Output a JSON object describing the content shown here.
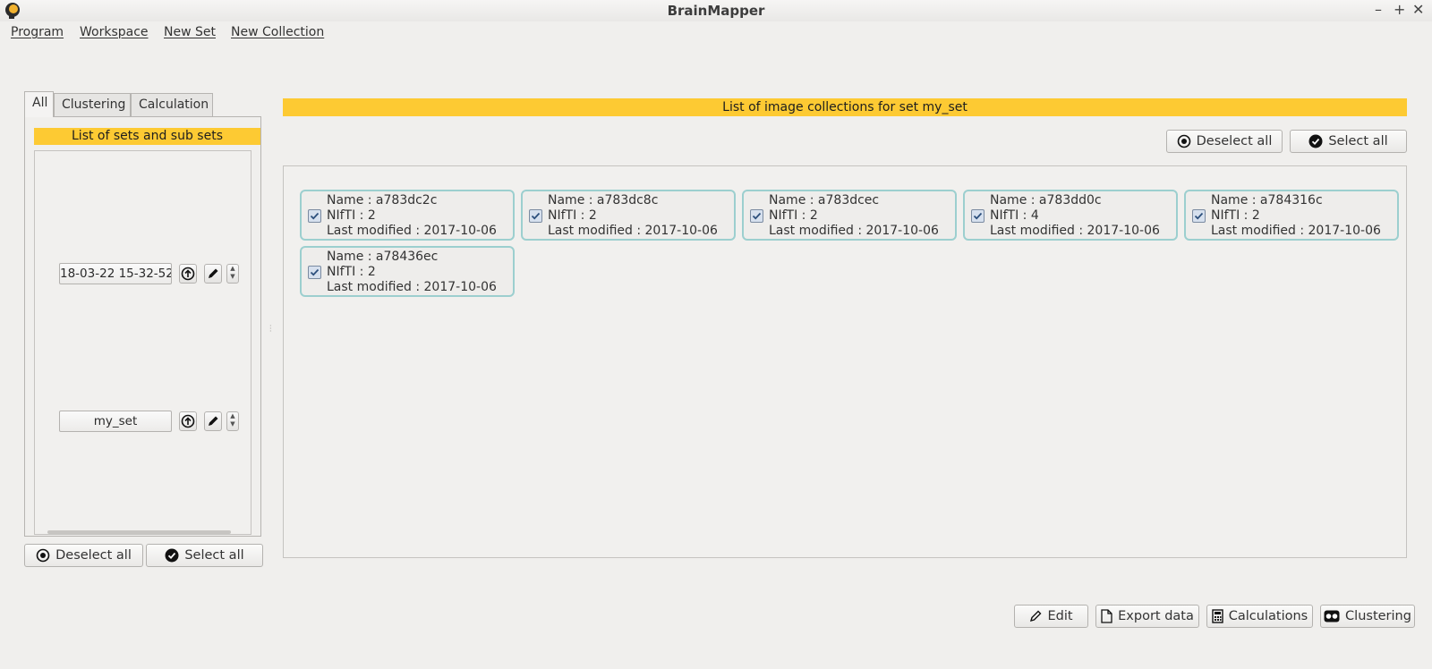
{
  "window": {
    "title": "BrainMapper",
    "minimize_glyph": "–",
    "maximize_glyph": "+",
    "close_glyph": "✕"
  },
  "menu": [
    "Program",
    "Workspace",
    "New Set",
    "New Collection"
  ],
  "left_panel": {
    "tabs": [
      "All",
      "Clustering",
      "Calculation"
    ],
    "active_tab": "All",
    "header": "List of sets and sub sets",
    "sets": [
      {
        "label": "18-03-22 15-32-52"
      },
      {
        "label": "my_set"
      }
    ],
    "deselect_all": "Deselect all",
    "select_all": "Select all"
  },
  "main_panel": {
    "header": "List of image collections for set my_set",
    "deselect_all": "Deselect all",
    "select_all": "Select all",
    "collections": [
      {
        "name": "Name : a783dc2c",
        "nifti": "NIfTI : 2",
        "modified": "Last modified : 2017-10-06",
        "checked": true
      },
      {
        "name": "Name : a783dc8c",
        "nifti": "NIfTI : 2",
        "modified": "Last modified : 2017-10-06",
        "checked": true
      },
      {
        "name": "Name : a783dcec",
        "nifti": "NIfTI : 2",
        "modified": "Last modified : 2017-10-06",
        "checked": true
      },
      {
        "name": "Name : a783dd0c",
        "nifti": "NIfTI : 4",
        "modified": "Last modified : 2017-10-06",
        "checked": true
      },
      {
        "name": "Name : a784316c",
        "nifti": "NIfTI : 2",
        "modified": "Last modified : 2017-10-06",
        "checked": true
      },
      {
        "name": "Name : a78436ec",
        "nifti": "NIfTI : 2",
        "modified": "Last modified : 2017-10-06",
        "checked": true
      }
    ]
  },
  "actions": {
    "edit": "Edit",
    "export": "Export data",
    "calculations": "Calculations",
    "clustering": "Clustering"
  },
  "colors": {
    "header_yellow": "#fdca33",
    "card_border": "#9ccfcf"
  }
}
